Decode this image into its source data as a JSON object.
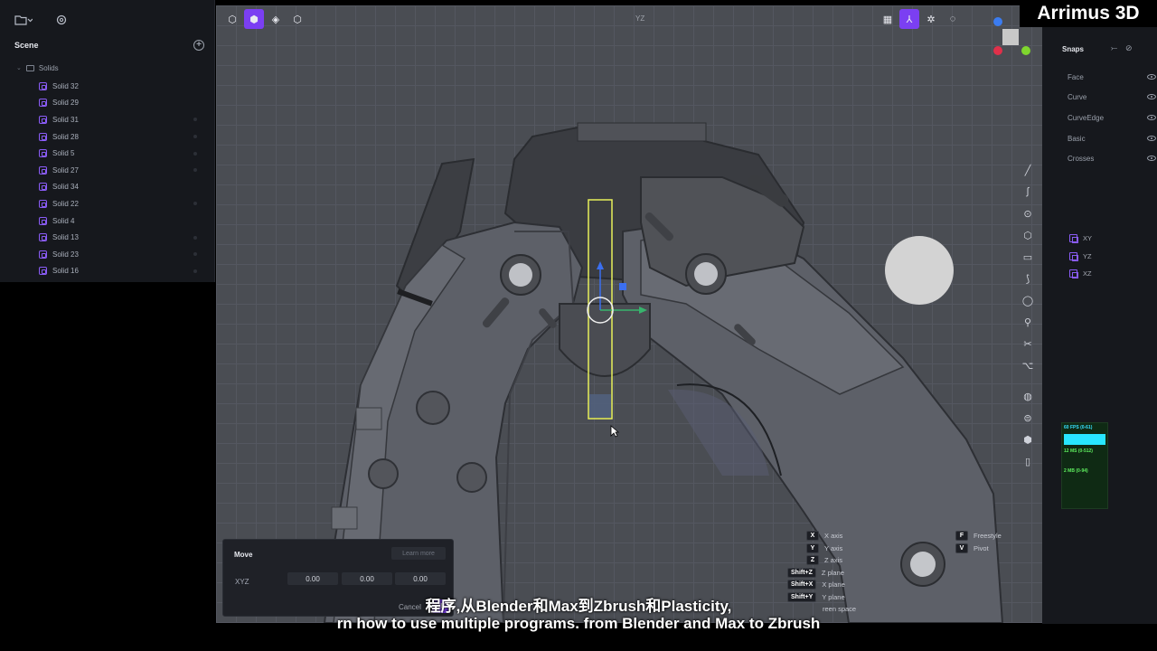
{
  "left_panel": {
    "scene_label": "Scene",
    "add_icon": "plus-circle-icon",
    "folder_label": "Solids",
    "items": [
      {
        "label": "Solid 32"
      },
      {
        "label": "Solid 29"
      },
      {
        "label": "Solid 31"
      },
      {
        "label": "Solid 28"
      },
      {
        "label": "Solid 5"
      },
      {
        "label": "Solid 27"
      },
      {
        "label": "Solid 34"
      },
      {
        "label": "Solid 22"
      },
      {
        "label": "Solid 4"
      },
      {
        "label": "Solid 13"
      },
      {
        "label": "Solid 23"
      },
      {
        "label": "Solid 16"
      }
    ]
  },
  "viewport": {
    "view_label": "YZ"
  },
  "move_panel": {
    "title": "Move",
    "learn_more": "Learn more",
    "xyz_label": "XYZ",
    "x": "0.00",
    "y": "0.00",
    "z": "0.00",
    "cancel": "Cancel",
    "ok": "OK"
  },
  "shortcuts": {
    "left": [
      {
        "key": "X",
        "label": "X axis"
      },
      {
        "key": "Y",
        "label": "Y axis"
      },
      {
        "key": "Z",
        "label": "Z axis"
      },
      {
        "key": "Shift+Z",
        "label": "Z plane"
      },
      {
        "key": "Shift+X",
        "label": "X plane"
      },
      {
        "key": "Shift+Y",
        "label": "Y plane"
      },
      {
        "key": "",
        "label": "reen space"
      }
    ],
    "right": [
      {
        "key": "F",
        "label": "Freestyle"
      },
      {
        "key": "V",
        "label": "Pivot"
      }
    ]
  },
  "snaps": {
    "title": "Snaps",
    "items": [
      {
        "label": "Face"
      },
      {
        "label": "Curve"
      },
      {
        "label": "CurveEdge"
      },
      {
        "label": "Basic"
      },
      {
        "label": "Crosses"
      }
    ],
    "planes": [
      {
        "label": "XY"
      },
      {
        "label": "YZ"
      },
      {
        "label": "XZ"
      }
    ],
    "stats": {
      "fps": "60 FPS (0-61)",
      "ms": "12 MS (0-512)",
      "mb": "2 MB (0-94)"
    }
  },
  "logo": "Arrimus 3D",
  "subtitles": {
    "line1": "程序,从Blender和Max到Zbrush和Plasticity,",
    "line2": "rn how to use multiple programs. from Blender and Max to Zbrush"
  },
  "colors": {
    "accent": "#7b3ff2",
    "selection": "#e8f05a"
  }
}
